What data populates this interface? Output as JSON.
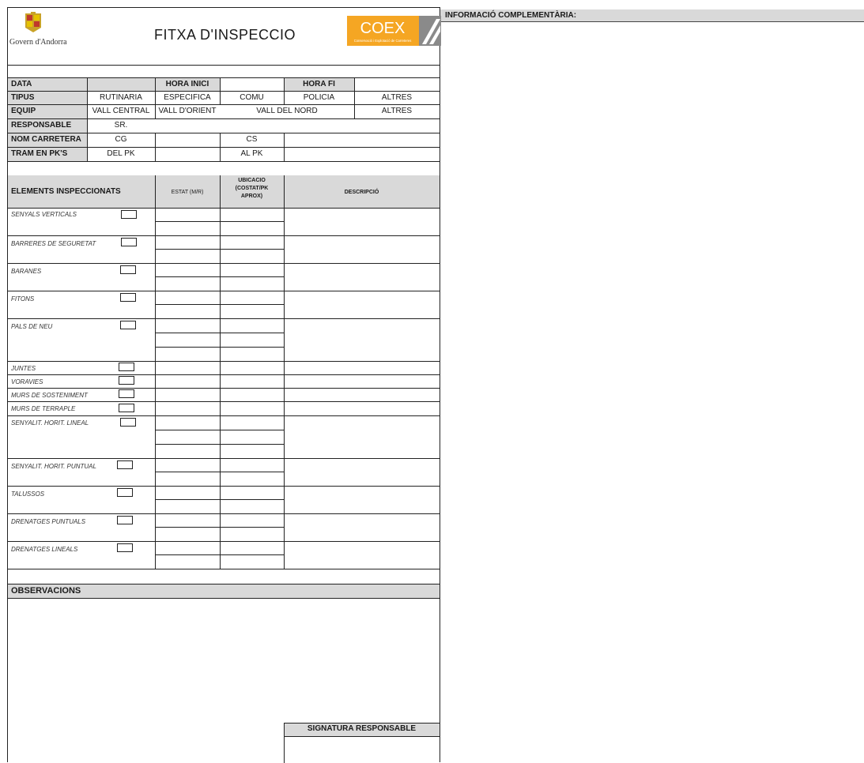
{
  "header": {
    "org_name": "Govern d'Andorra",
    "title": "FITXA D'INSPECCIO",
    "logo_text": "COEX",
    "logo_subtitle": "Conservació i Explotació de Carreteres"
  },
  "info_panel": {
    "title": "INFORMACIÓ COMPLEMENTÀRIA:"
  },
  "general": {
    "data_label": "DATA",
    "hora_inici_label": "HORA INICI",
    "hora_fi_label": "HORA FI",
    "tipus_label": "TIPUS",
    "tipus_options": [
      "RUTINARIA",
      "ESPECIFICA",
      "COMU",
      "POLICIA",
      "ALTRES"
    ],
    "equip_label": "EQUIP",
    "equip_options": [
      "VALL CENTRAL",
      "VALL D'ORIENT",
      "VALL DEL NORD",
      "ALTRES"
    ],
    "responsable_label": "RESPONSABLE",
    "responsable_value": "SR.",
    "nom_carretera_label": "NOM CARRETERA",
    "cg_label": "CG",
    "cs_label": "CS",
    "tram_label": "TRAM EN PK'S",
    "del_pk_label": "DEL PK",
    "al_pk_label": "AL PK"
  },
  "elements": {
    "header_label": "ELEMENTS INSPECCIONATS",
    "estat_label": "ESTAT (M/R)",
    "ubicacio_lines": [
      "UBICACIO",
      "(COSTAT/PK",
      "APROX)"
    ],
    "descripcio_label": "DESCRIPCIÓ",
    "items": [
      "SENYALS VERTICALS",
      "BARRERES DE SEGURETAT",
      "BARANES",
      "FITONS",
      "PALS DE NEU",
      "JUNTES",
      "VORAVIES",
      "MURS DE SOSTENIMENT",
      "MURS DE TERRAPLE",
      "SENYALIT. HORIT. LINEAL",
      "SENYALIT. HORIT. PUNTUAL",
      "TALUSSOS",
      "DRENATGES PUNTUALS",
      "DRENATGES LINEALS"
    ]
  },
  "observacions": {
    "label": "OBSERVACIONS"
  },
  "signatura": {
    "label": "SIGNATURA RESPONSABLE"
  },
  "colors": {
    "header_grey": "#d9d9d9",
    "coex_orange": "#f5a623",
    "coex_grey": "#6b6b6b"
  }
}
